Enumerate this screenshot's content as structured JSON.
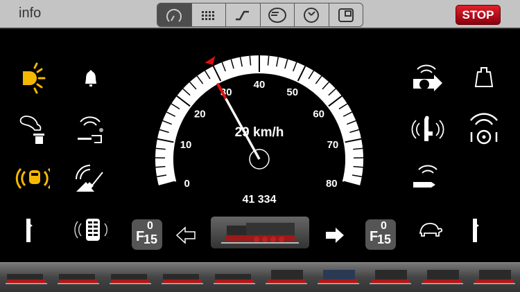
{
  "header": {
    "info_label": "info",
    "stop_label": "STOP",
    "tabs": [
      "speedometer",
      "keypad",
      "track",
      "locomotive",
      "clock",
      "layout"
    ],
    "active_tab": 0
  },
  "speedometer": {
    "speed": 29,
    "speed_text": "29 km/h",
    "unit": "km/h",
    "max": 80,
    "target": 30,
    "labels": [
      "0",
      "10",
      "20",
      "30",
      "40",
      "50",
      "60",
      "70",
      "80"
    ],
    "odometer": "41 334"
  },
  "functions_left": [
    "headlight-icon",
    "bell-icon",
    "smoke-icon",
    "sound-brake-icon",
    "warning-horn-icon",
    "shovel-sound-icon",
    "door-left-icon",
    "vibration-icon"
  ],
  "functions_right": [
    "ventilator-sound-icon",
    "weight-icon",
    "water-pump-icon",
    "air-pump-icon",
    "whistle-icon",
    "turtle-icon",
    "door-right-icon"
  ],
  "function_group": {
    "prefix": "F",
    "top": "0",
    "bottom": "15"
  },
  "colors": {
    "active": "#f5b800",
    "stop": "#d01020",
    "needle_tip": "#e01010"
  },
  "loco_count": 10
}
